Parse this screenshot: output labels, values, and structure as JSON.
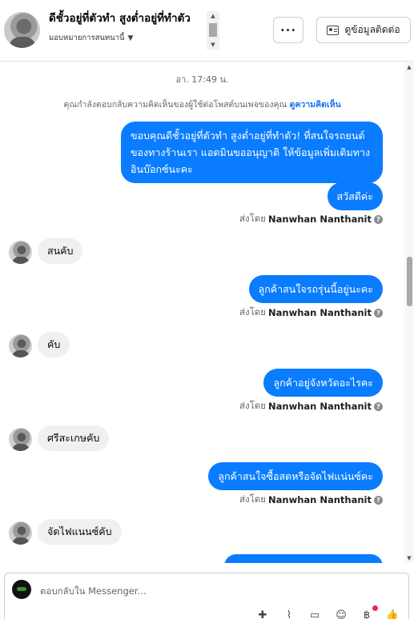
{
  "header": {
    "title": "ดีชั้วอยู่ที่ตัวทำ สูงต่ำอยู่ที่ทำตัว",
    "subtitle": "มอบหมายการสนทนานี้",
    "more_label": "···",
    "contact_label": "ดูข้อมูลติดต่อ"
  },
  "conversation": {
    "timestamp": "อา. 17:49 น.",
    "context_text": "คุณกำลังตอบกลับความคิดเห็นของผู้ใช้ต่อโพสต์บนเพจของคุณ",
    "context_link": "ดูความคิดเห็น",
    "sent_by_prefix": "ส่งโดย",
    "sent_by_name": "Nanwhan Nanthanit",
    "messages": [
      {
        "text": "ขอบคุณดีชั้วอยู่ที่ตัวทำ สูงต่ำอยู่ที่ทำตัว! ที่สนใจรถยนต์ของทางร้านเรา แอดมินขออนุญาติ ให้ข้อมูลเพิ่มเติมทางอินบ๊อกซ์นะคะ"
      },
      {
        "text": "สวัสดีค่ะ"
      },
      {
        "text": "สนคับ"
      },
      {
        "text": "ลูกค้าสนใจรถรุ่นนี้อยู่นะคะ"
      },
      {
        "text": "คับ"
      },
      {
        "text": "ลูกค้าอยู่จังหวัดอะไรคะ"
      },
      {
        "text": "ศรีสะเกษคับ"
      },
      {
        "text": "ลูกค้าสนใจซื้อสดหรือจัดไฟแน่นซ์คะ"
      },
      {
        "text": "จัดไฟแนนซ์คับ"
      }
    ]
  },
  "composer": {
    "placeholder": "ตอบกลับใน Messenger..."
  },
  "icons": [
    "chevron-up-icon",
    "chevron-down-icon",
    "ellipsis-icon",
    "contact-card-icon",
    "info-icon",
    "gif-icon",
    "attachment-icon",
    "chat-icon",
    "emoji-icon",
    "currency-icon",
    "thumbs-up-icon"
  ],
  "colors": {
    "outgoing_bubble": "#0a7cff",
    "incoming_bubble": "#f0f0f0",
    "link": "#1877f2",
    "notification": "#f02849"
  }
}
